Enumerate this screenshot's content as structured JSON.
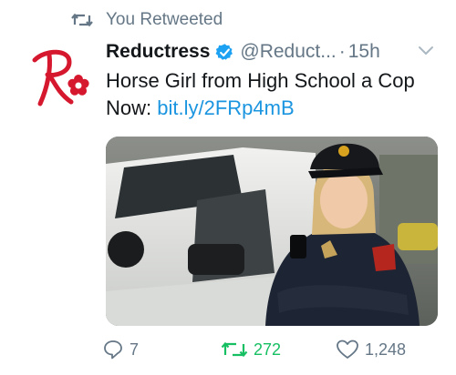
{
  "context": {
    "retweet_label": "You Retweeted"
  },
  "tweet": {
    "author_name": "Reductress",
    "handle": "@Reduct...",
    "separator": "·",
    "time": "15h",
    "text": "Horse Girl from High School a Cop Now:",
    "link": "bit.ly/2FRp4mB"
  },
  "actions": {
    "replies": "7",
    "retweets": "272",
    "likes": "1,248",
    "retweet_active_color": "#17bf63"
  },
  "colors": {
    "link": "#1b95e0",
    "verified": "#1da1f2",
    "brand_red": "#d6182f"
  }
}
